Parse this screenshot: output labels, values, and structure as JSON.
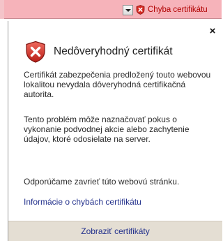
{
  "address_bar": {
    "cert_error_label": "Chyba certifikátu",
    "color": "#f6b3ba"
  },
  "popup": {
    "title": "Nedôveryhodný certifikát",
    "paragraphs": [
      "Certifikát zabezpečenia predložený touto webovou lokalitou nevydala dôveryhodná certifikačná autorita.",
      "Tento problém môže naznačovať pokus o vykonanie podvodnej akcie alebo zachytenie údajov, ktoré odosielate na server.",
      "Odporúčame zavrieť túto webovú stránku."
    ],
    "link_errors": "Informácie o chybách certifikátu",
    "view_certificates": "Zobraziť certifikáty",
    "close_symbol": "×",
    "icon": "shield-error-icon",
    "link_color": "#23318c",
    "footer_color": "#e4ded3"
  }
}
